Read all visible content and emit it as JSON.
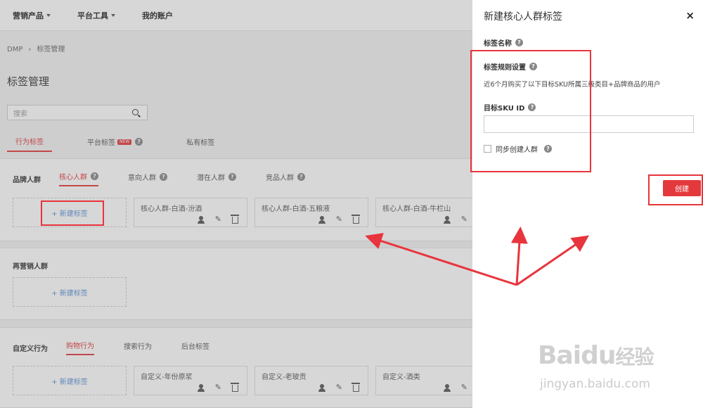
{
  "topnav": {
    "items": [
      {
        "label": "营销产品",
        "dropdown": true
      },
      {
        "label": "平台工具",
        "dropdown": true
      },
      {
        "label": "我的账户",
        "dropdown": false
      }
    ]
  },
  "breadcrumb": {
    "root": "DMP",
    "separator": "›",
    "current": "标签管理"
  },
  "page_title": "标签管理",
  "search": {
    "placeholder": "搜索"
  },
  "main_tabs": [
    {
      "label": "行为标签",
      "active": true
    },
    {
      "label": "平台标签",
      "badge": "NEW",
      "active": false
    },
    {
      "label": "私有标签",
      "active": false
    }
  ],
  "brand_section": {
    "title": "品牌人群",
    "tabs": [
      {
        "label": "核心人群",
        "active": true
      },
      {
        "label": "意向人群",
        "active": false
      },
      {
        "label": "潜在人群",
        "active": false
      },
      {
        "label": "竞品人群",
        "active": false
      }
    ],
    "add_label": "+ 新建标签",
    "cards": [
      "核心人群-白酒-汾酒",
      "核心人群-白酒-五粮液",
      "核心人群-白酒-牛栏山"
    ]
  },
  "remarketing_section": {
    "title": "再营销人群",
    "add_label": "+ 新建标签"
  },
  "custom_section": {
    "title": "自定义行为",
    "tabs": [
      {
        "label": "购物行为",
        "active": true
      },
      {
        "label": "搜索行为",
        "active": false
      },
      {
        "label": "后台标签",
        "active": false
      }
    ],
    "add_label": "+ 新建标签",
    "cards": [
      "自定义-年份原浆",
      "自定义-老玻贡",
      "自定义-酒类"
    ]
  },
  "drawer": {
    "title": "新建核心人群标签",
    "close": "×",
    "name_label": "标签名称",
    "rule_label": "标签规则设置",
    "rule_text": "近6个月购买了以下目标SKU所属三级类目+品牌商品的用户",
    "sku_label": "目标SKU ID",
    "sku_value": "",
    "sync_label": "同步创建人群",
    "sync_checked": false,
    "create_button": "创建"
  },
  "watermark": {
    "brand_a": "Bai",
    "brand_b": "du",
    "brand_c": "经验",
    "url": "jingyan.baidu.com"
  },
  "colors": {
    "accent": "#e4393c",
    "link": "#5b8fd6",
    "annotation": "#e8343c"
  }
}
